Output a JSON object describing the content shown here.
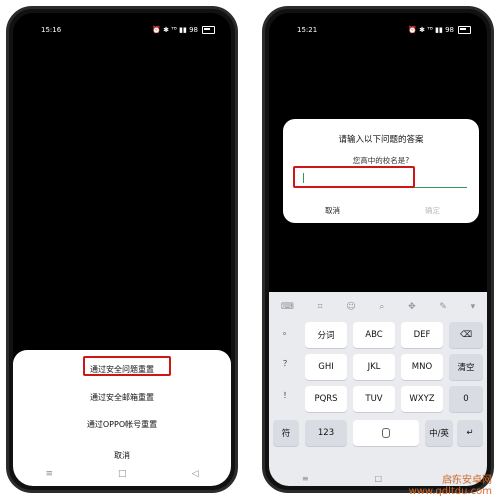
{
  "left_phone": {
    "time": "15:16",
    "status_icons": "⏰ ✱ ᵀᴮ ▮▮ 98",
    "sheet_options": [
      "通过安全问题重置",
      "通过安全邮箱重置",
      "通过OPPO帐号重置"
    ],
    "cancel": "取消",
    "nav_icons": [
      "≡",
      "□",
      "◁"
    ]
  },
  "right_phone": {
    "time": "15:21",
    "status_icons": "⏰ ✱ ᵀᴮ ▮▮ 98",
    "dialog": {
      "title": "请输入以下问题的答案",
      "question": "您高中的校名是?",
      "input_value": "",
      "cancel": "取消",
      "confirm": "确定"
    },
    "keyboard": {
      "toolbar_icons": [
        "⌨",
        "⌗",
        "☺",
        "⌕",
        "✥",
        "✎",
        "▾"
      ],
      "side_punct": [
        "。",
        "？",
        "！"
      ],
      "rows": [
        [
          "分词",
          "ABC",
          "DEF",
          "⌫"
        ],
        [
          "GHI",
          "JKL",
          "MNO",
          "清空"
        ],
        [
          "PQRS",
          "TUV",
          "WXYZ",
          "0"
        ]
      ],
      "bottom": {
        "symbols": "符",
        "num": "123",
        "space": "",
        "lang": "中/英",
        "enter": "↵"
      }
    },
    "nav_icons": [
      "≡",
      "□",
      "◁"
    ]
  },
  "watermark": "启东安卓网\nwww.qdltdu.com"
}
